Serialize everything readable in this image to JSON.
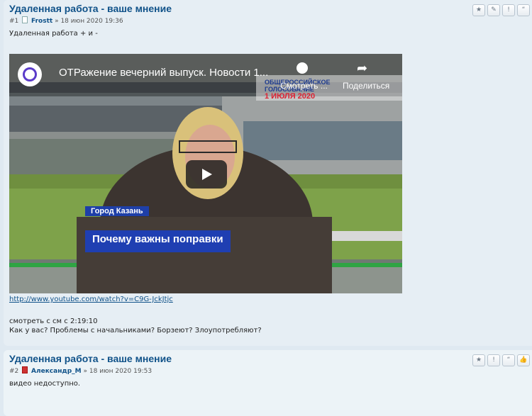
{
  "post1": {
    "title": "Удаленная работа - ваше мнение",
    "number": "#1",
    "author": "Frostt",
    "date_sep": "»",
    "date": "18 июн 2020 19:36",
    "intro": "Удаленная работа + и -",
    "video": {
      "title": "ОТРажение вечерний выпуск. Новости 1...",
      "watch_later": "Смотреть ...",
      "share": "Поделиться",
      "voting_line1": "ОБЩЕРОССИЙСКОЕ",
      "voting_line2": "ГОЛОСОВАНИЕ",
      "voting_date": "1 ИЮЛЯ 2020",
      "lower_third_place": "Город Казань",
      "lower_third_caption": "Почему важны поправки"
    },
    "link": "http://www.youtube.com/watch?v=C9G-JckJtjc",
    "line1": "смотреть с см с 2:19:10",
    "line2": "Как у вас? Проблемы с начальниками? Борзеют? Злоупотребляют?",
    "buttons": [
      {
        "icon": "star-icon",
        "glyph": "★"
      },
      {
        "icon": "pencil-icon",
        "glyph": "✎"
      },
      {
        "icon": "exclamation-icon",
        "glyph": "!"
      },
      {
        "icon": "quote-icon",
        "glyph": "“"
      }
    ]
  },
  "post2": {
    "title": "Удаленная работа - ваше мнение",
    "number": "#2",
    "author": "Александр_М",
    "date_sep": "»",
    "date": "18 июн 2020 19:53",
    "body": "видео недоступно.",
    "buttons": [
      {
        "icon": "star-icon",
        "glyph": "★"
      },
      {
        "icon": "exclamation-icon",
        "glyph": "!"
      },
      {
        "icon": "quote-icon",
        "glyph": "“"
      },
      {
        "icon": "thumbs-up-icon",
        "glyph": "👍"
      }
    ]
  }
}
